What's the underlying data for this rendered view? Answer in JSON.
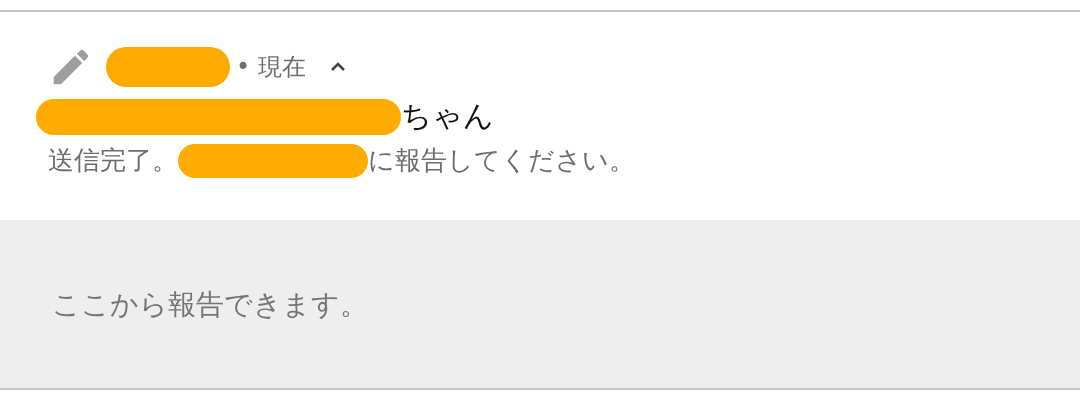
{
  "notification": {
    "header": [
      {
        "kind": "redaction"
      },
      {
        "kind": "text",
        "text": "• 現在"
      }
    ],
    "expanded": true,
    "title": [
      {
        "kind": "redaction"
      },
      {
        "kind": "text",
        "text": "ちゃん"
      }
    ],
    "body": [
      {
        "kind": "text",
        "text": "送信完了。"
      },
      {
        "kind": "redaction"
      },
      {
        "kind": "text",
        "text": "に報告してください。"
      }
    ]
  },
  "reply_area": {
    "placeholder": "ここから報告できます。"
  }
}
